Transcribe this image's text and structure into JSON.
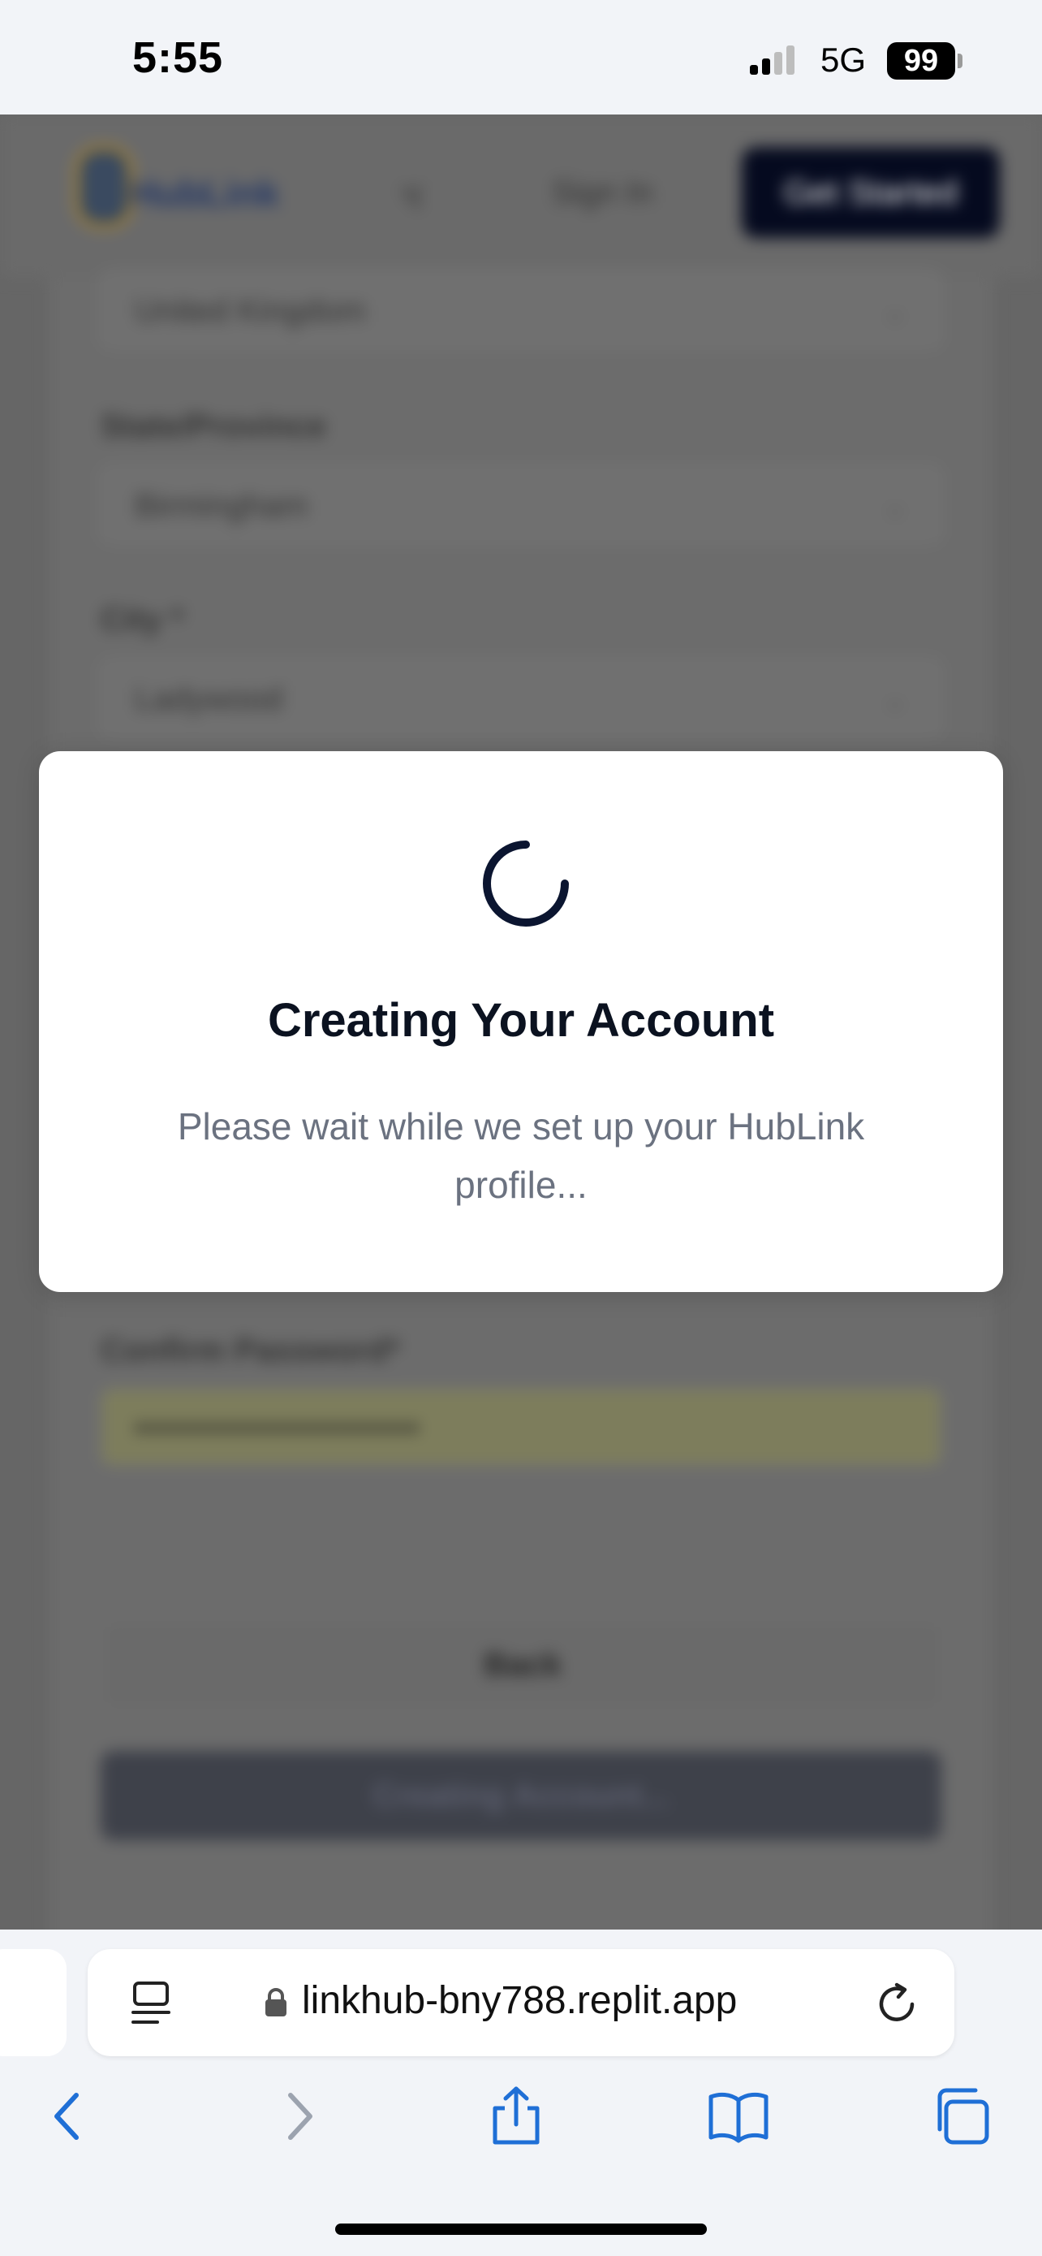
{
  "status_bar": {
    "time": "5:55",
    "network": "5G",
    "battery": "99"
  },
  "background_page": {
    "logo_text": "HubLink",
    "language_label": "খ",
    "sign_in_label": "Sign In",
    "get_started_label": "Get Started",
    "country_value": "United Kingdom",
    "state_label": "State/Province",
    "state_value": "Birmingham",
    "city_label": "City *",
    "city_value": "Ladywood",
    "confirm_password_label": "Confirm Password*",
    "confirm_password_value": "••••••••••••••••••••••",
    "back_label": "Back",
    "creating_label": "Creating Account..."
  },
  "modal": {
    "title": "Creating Your Account",
    "message": "Please wait while we set up your HubLink profile..."
  },
  "browser": {
    "url": "linkhub-bny788.replit.app",
    "accent_color": "#1f6fd6"
  }
}
